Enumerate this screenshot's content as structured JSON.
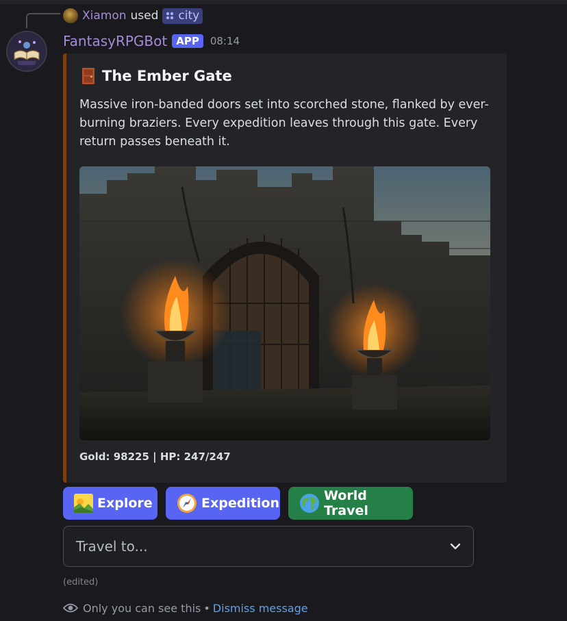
{
  "reply": {
    "user": "Xiamon",
    "action": "used",
    "command": "city"
  },
  "message": {
    "author": "FantasyRPGBot",
    "badge": "APP",
    "time": "08:14"
  },
  "embed": {
    "accent_color": "#7b3f10",
    "title": "The Ember Gate",
    "title_icon": "door-icon",
    "description": "Massive iron-banded doors set into scorched stone, flanked by ever-burning braziers. Every expedition leaves through this gate. Every return passes beneath it.",
    "footer": "Gold: 98225 | HP: 247/247"
  },
  "buttons": [
    {
      "label": "Explore",
      "icon": "sunrise-mountains-icon",
      "color": "#5865f2"
    },
    {
      "label": "Expedition",
      "icon": "compass-icon",
      "color": "#5865f2"
    },
    {
      "label": "World Travel",
      "icon": "globe-icon",
      "color": "#248046"
    }
  ],
  "select": {
    "placeholder": "Travel to..."
  },
  "edited_label": "(edited)",
  "ephemeral": {
    "notice": "Only you can see this",
    "separator": "•",
    "dismiss": "Dismiss message"
  }
}
